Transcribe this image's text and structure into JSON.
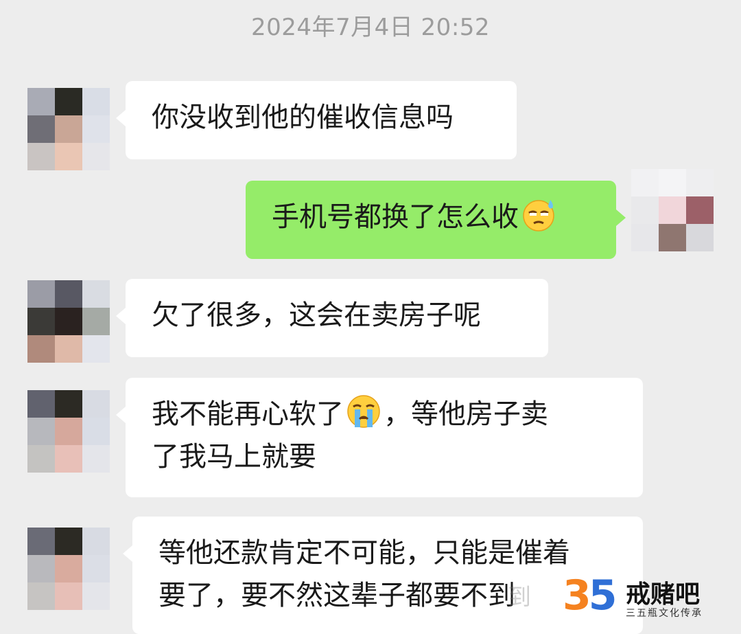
{
  "timestamp": "2024年7月4日 20:52",
  "messages": [
    {
      "side": "left",
      "text": "你没收到他的催收信息吗"
    },
    {
      "side": "right",
      "text": "手机号都换了怎么收",
      "emoji": "sweat-emoji"
    },
    {
      "side": "left",
      "text": "欠了很多，这会在卖房子呢"
    },
    {
      "side": "left",
      "text_a": "我不能再心软了",
      "emoji": "crying-emoji",
      "text_b": "，等他房子卖",
      "text_c": "了我马上就要"
    },
    {
      "side": "left",
      "text_a": "等他还款肯定不可能，只能是催着",
      "text_b": "要了，要不然这辈子都要不到"
    }
  ],
  "watermark": "到",
  "logo": {
    "mark_a": "3",
    "mark_b": "5",
    "title": "戒赌吧",
    "subtitle": "三五瓶文化传承"
  },
  "colors": {
    "background": "#ededed",
    "incoming": "#ffffff",
    "outgoing": "#95ec69",
    "timestamp": "#9c9c9c"
  }
}
